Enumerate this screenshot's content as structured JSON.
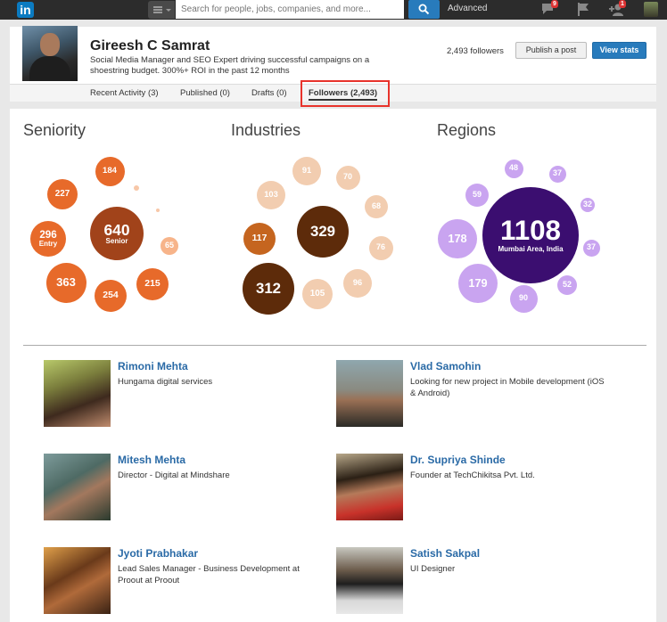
{
  "topbar": {
    "logo_text": "in",
    "search_placeholder": "Search for people, jobs, companies, and more...",
    "advanced_label": "Advanced",
    "messages_badge": "9",
    "connections_badge": "1"
  },
  "profile": {
    "name": "Gireesh C Samrat",
    "headline": "Social Media Manager and SEO Expert driving successful campaigns on a shoestring budget. 300%+ ROI in the past 12 months",
    "followers_text": "2,493 followers",
    "publish_label": "Publish a post",
    "stats_label": "View stats"
  },
  "tabs": [
    {
      "label": "Recent Activity (3)"
    },
    {
      "label": "Published (0)"
    },
    {
      "label": "Drafts (0)"
    },
    {
      "label": "Followers (2,493)"
    }
  ],
  "sections": {
    "seniority": "Seniority",
    "industries": "Industries",
    "regions": "Regions"
  },
  "colors": {
    "brand_blue": "#287bbc",
    "highlight_red": "#e8332b",
    "seniority": [
      "#f7b48a",
      "#e76a2a",
      "#a1431a"
    ],
    "industries": [
      "#f2cdb0",
      "#c5651f",
      "#5d2b0a"
    ],
    "regions": [
      "#c9a4f0",
      "#7b3fd0",
      "#3b0e70"
    ]
  },
  "chart_data": [
    {
      "type": "bubble",
      "title": "Seniority",
      "points": [
        {
          "value": 640,
          "label": "Senior"
        },
        {
          "value": 296,
          "label": "Entry"
        },
        {
          "value": 363,
          "label": ""
        },
        {
          "value": 254,
          "label": ""
        },
        {
          "value": 215,
          "label": ""
        },
        {
          "value": 227,
          "label": ""
        },
        {
          "value": 184,
          "label": ""
        },
        {
          "value": 65,
          "label": ""
        }
      ]
    },
    {
      "type": "bubble",
      "title": "Industries",
      "points": [
        {
          "value": 329,
          "label": ""
        },
        {
          "value": 312,
          "label": ""
        },
        {
          "value": 117,
          "label": ""
        },
        {
          "value": 103,
          "label": ""
        },
        {
          "value": 105,
          "label": ""
        },
        {
          "value": 96,
          "label": ""
        },
        {
          "value": 91,
          "label": ""
        },
        {
          "value": 76,
          "label": ""
        },
        {
          "value": 70,
          "label": ""
        },
        {
          "value": 68,
          "label": ""
        }
      ]
    },
    {
      "type": "bubble",
      "title": "Regions",
      "points": [
        {
          "value": 1108,
          "label": "Mumbai Area, India"
        },
        {
          "value": 178,
          "label": ""
        },
        {
          "value": 179,
          "label": ""
        },
        {
          "value": 90,
          "label": ""
        },
        {
          "value": 59,
          "label": ""
        },
        {
          "value": 52,
          "label": ""
        },
        {
          "value": 48,
          "label": ""
        },
        {
          "value": 37,
          "label": ""
        },
        {
          "value": 37,
          "label": ""
        },
        {
          "value": 32,
          "label": ""
        }
      ]
    }
  ],
  "followers": [
    {
      "name": "Rimoni Mehta",
      "title": "Hungama digital services"
    },
    {
      "name": "Vlad Samohin",
      "title": "Looking for new project in Mobile development (iOS & Android)"
    },
    {
      "name": "Mitesh Mehta",
      "title": "Director - Digital at Mindshare"
    },
    {
      "name": "Dr. Supriya Shinde",
      "title": "Founder at TechChikitsa Pvt. Ltd."
    },
    {
      "name": "Jyoti Prabhakar",
      "title": "Lead Sales Manager - Business Development at Proout at Proout"
    },
    {
      "name": "Satish Sakpal",
      "title": "UI Designer"
    }
  ]
}
